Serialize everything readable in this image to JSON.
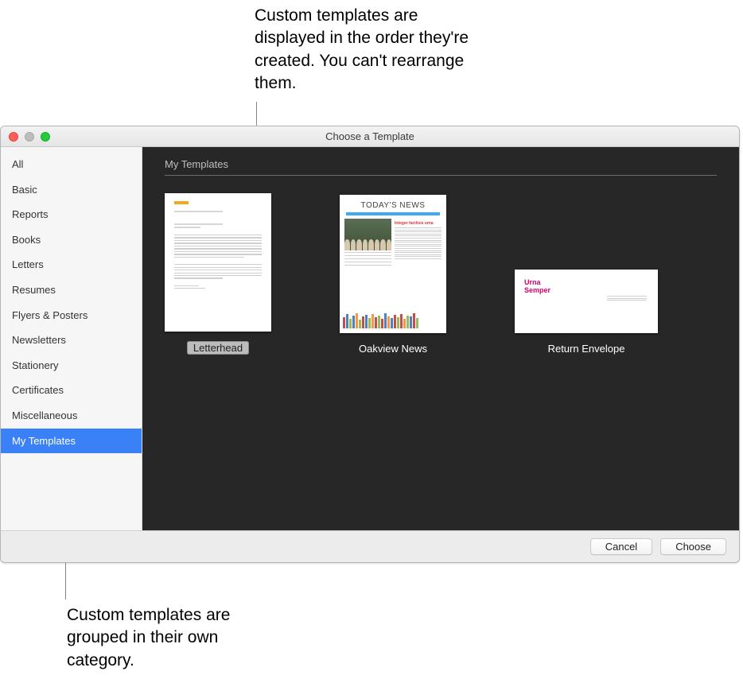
{
  "callouts": {
    "top": "Custom templates are displayed in the order they're created. You can't rearrange them.",
    "bottom": "Custom templates are grouped in their own category."
  },
  "window": {
    "title": "Choose a Template"
  },
  "sidebar": {
    "items": [
      {
        "label": "All"
      },
      {
        "label": "Basic"
      },
      {
        "label": "Reports"
      },
      {
        "label": "Books"
      },
      {
        "label": "Letters"
      },
      {
        "label": "Resumes"
      },
      {
        "label": "Flyers & Posters"
      },
      {
        "label": "Newsletters"
      },
      {
        "label": "Stationery"
      },
      {
        "label": "Certificates"
      },
      {
        "label": "Miscellaneous"
      },
      {
        "label": "My Templates"
      }
    ],
    "selected_index": 11
  },
  "content": {
    "section_title": "My Templates",
    "templates": [
      {
        "label": "Letterhead"
      },
      {
        "label": "Oakview News"
      },
      {
        "label": "Return Envelope"
      }
    ],
    "editing_index": 0
  },
  "thumbs": {
    "news_headline": "TODAY'S NEWS",
    "news_subhead": "Integer facilisis urna",
    "env_name1": "Urna",
    "env_name2": "Semper"
  },
  "footer": {
    "cancel": "Cancel",
    "choose": "Choose"
  }
}
